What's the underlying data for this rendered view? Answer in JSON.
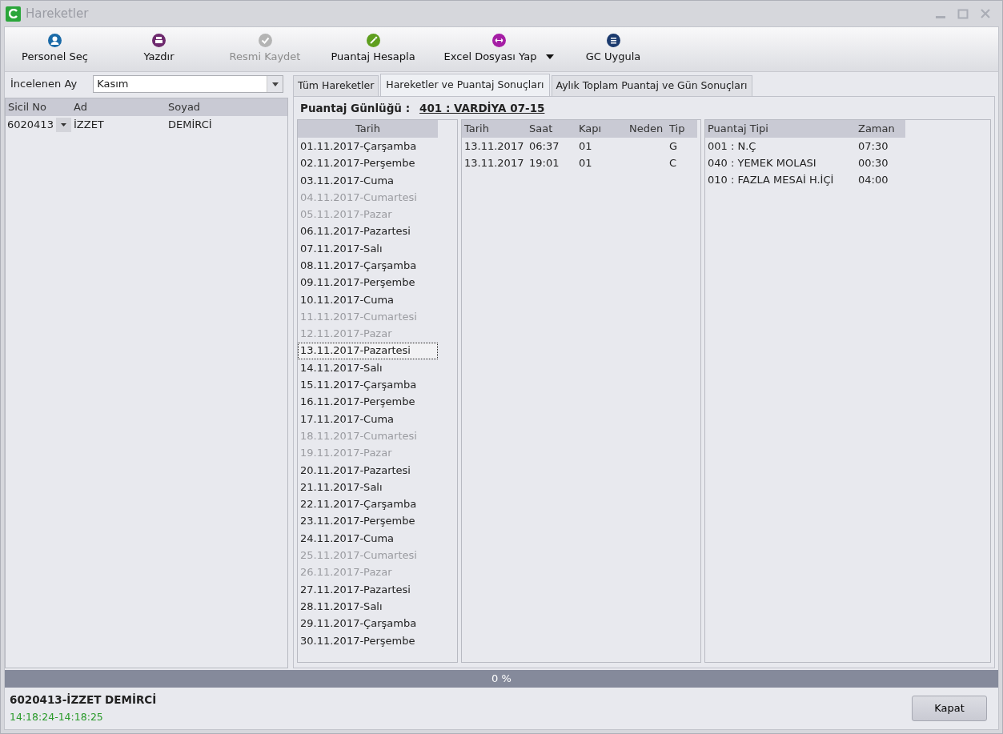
{
  "window": {
    "title": "Hareketler"
  },
  "toolbar": [
    {
      "label": "Personel Seç",
      "kind": "person",
      "color": "#1a6aa8",
      "disabled": false,
      "dropdown": false
    },
    {
      "label": "Yazdır",
      "kind": "printer",
      "color": "#6e2a6e",
      "disabled": false,
      "dropdown": false
    },
    {
      "label": "Resmi Kaydet",
      "kind": "check",
      "color": "#b4b4b4",
      "disabled": true,
      "dropdown": false
    },
    {
      "label": "Puantaj Hesapla",
      "kind": "wand",
      "color": "#5e9e1e",
      "disabled": false,
      "dropdown": false
    },
    {
      "label": "Excel Dosyası Yap",
      "kind": "arrows",
      "color": "#a51ea5",
      "disabled": false,
      "dropdown": true
    },
    {
      "label": "GC Uygula",
      "kind": "list",
      "color": "#1b3a6e",
      "disabled": false,
      "dropdown": false
    }
  ],
  "month_filter": {
    "label": "İncelenen Ay",
    "value": "Kasım"
  },
  "personnel_table": {
    "columns": [
      "Sicil No",
      "Ad",
      "Soyad"
    ],
    "rows": [
      [
        "6020413",
        "İZZET",
        "DEMİRCİ"
      ]
    ]
  },
  "tabs": [
    {
      "label": "Tüm Hareketler",
      "selected": false
    },
    {
      "label": "Hareketler ve Puantaj Sonuçları",
      "selected": true
    },
    {
      "label": "Aylık Toplam Puantaj  ve Gün Sonuçları",
      "selected": false
    }
  ],
  "journal": {
    "label": "Puantaj Günlüğü :",
    "shift": "401 : VARDİYA 07-15"
  },
  "days": {
    "column": "Tarih",
    "rows": [
      {
        "text": "01.11.2017-Çarşamba",
        "weekend": false,
        "selected": false
      },
      {
        "text": "02.11.2017-Perşembe",
        "weekend": false,
        "selected": false
      },
      {
        "text": "03.11.2017-Cuma",
        "weekend": false,
        "selected": false
      },
      {
        "text": "04.11.2017-Cumartesi",
        "weekend": true,
        "selected": false
      },
      {
        "text": "05.11.2017-Pazar",
        "weekend": true,
        "selected": false
      },
      {
        "text": "06.11.2017-Pazartesi",
        "weekend": false,
        "selected": false
      },
      {
        "text": "07.11.2017-Salı",
        "weekend": false,
        "selected": false
      },
      {
        "text": "08.11.2017-Çarşamba",
        "weekend": false,
        "selected": false
      },
      {
        "text": "09.11.2017-Perşembe",
        "weekend": false,
        "selected": false
      },
      {
        "text": "10.11.2017-Cuma",
        "weekend": false,
        "selected": false
      },
      {
        "text": "11.11.2017-Cumartesi",
        "weekend": true,
        "selected": false
      },
      {
        "text": "12.11.2017-Pazar",
        "weekend": true,
        "selected": false
      },
      {
        "text": "13.11.2017-Pazartesi",
        "weekend": false,
        "selected": true
      },
      {
        "text": "14.11.2017-Salı",
        "weekend": false,
        "selected": false
      },
      {
        "text": "15.11.2017-Çarşamba",
        "weekend": false,
        "selected": false
      },
      {
        "text": "16.11.2017-Perşembe",
        "weekend": false,
        "selected": false
      },
      {
        "text": "17.11.2017-Cuma",
        "weekend": false,
        "selected": false
      },
      {
        "text": "18.11.2017-Cumartesi",
        "weekend": true,
        "selected": false
      },
      {
        "text": "19.11.2017-Pazar",
        "weekend": true,
        "selected": false
      },
      {
        "text": "20.11.2017-Pazartesi",
        "weekend": false,
        "selected": false
      },
      {
        "text": "21.11.2017-Salı",
        "weekend": false,
        "selected": false
      },
      {
        "text": "22.11.2017-Çarşamba",
        "weekend": false,
        "selected": false
      },
      {
        "text": "23.11.2017-Perşembe",
        "weekend": false,
        "selected": false
      },
      {
        "text": "24.11.2017-Cuma",
        "weekend": false,
        "selected": false
      },
      {
        "text": "25.11.2017-Cumartesi",
        "weekend": true,
        "selected": false
      },
      {
        "text": "26.11.2017-Pazar",
        "weekend": true,
        "selected": false
      },
      {
        "text": "27.11.2017-Pazartesi",
        "weekend": false,
        "selected": false
      },
      {
        "text": "28.11.2017-Salı",
        "weekend": false,
        "selected": false
      },
      {
        "text": "29.11.2017-Çarşamba",
        "weekend": false,
        "selected": false
      },
      {
        "text": "30.11.2017-Perşembe",
        "weekend": false,
        "selected": false
      }
    ]
  },
  "movements": {
    "columns": [
      "Tarih",
      "Saat",
      "Kapı",
      "Neden",
      "Tip"
    ],
    "rows": [
      [
        "13.11.2017",
        "06:37",
        "01",
        "",
        "G"
      ],
      [
        "13.11.2017",
        "19:01",
        "01",
        "",
        "C"
      ]
    ]
  },
  "results": {
    "columns": [
      "Puantaj Tipi",
      "Zaman"
    ],
    "rows": [
      [
        "001 : N.Ç",
        "07:30"
      ],
      [
        "040 : YEMEK MOLASI",
        "00:30"
      ],
      [
        "010 : FAZLA MESAİ H.İÇİ",
        "04:00"
      ]
    ]
  },
  "progress": {
    "level": 0,
    "reading": "0 %"
  },
  "footer": {
    "person": "6020413-İZZET DEMİRCİ",
    "time_range": "14:18:24-14:18:25",
    "close_button": "Kapat"
  }
}
